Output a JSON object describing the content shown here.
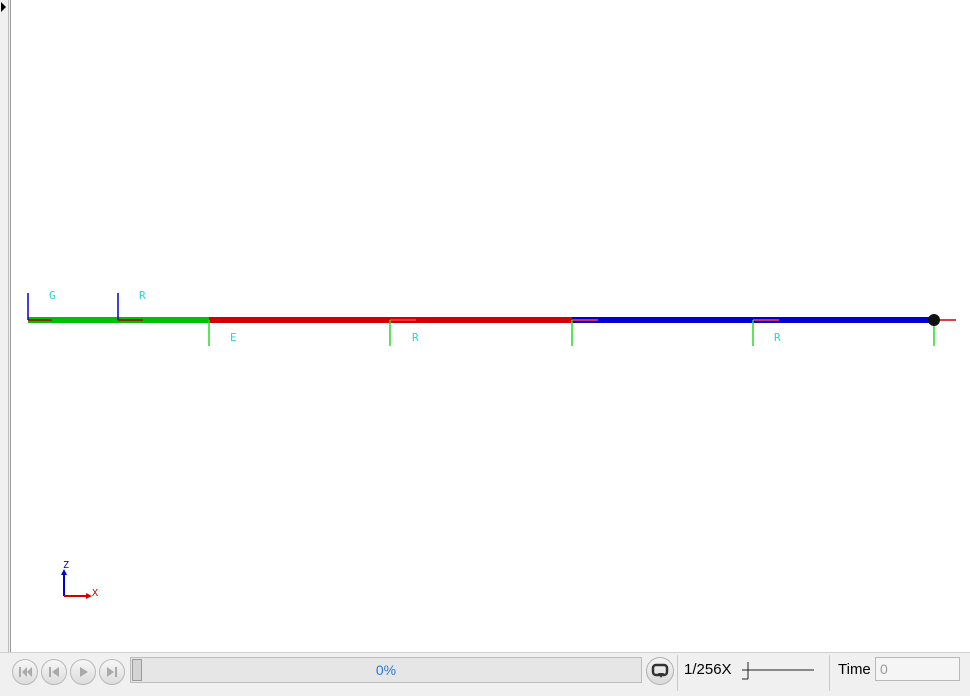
{
  "viewer": {
    "point_labels": {
      "top_1": "G",
      "top_2": "R",
      "bottom_1": "E",
      "bottom_2": "R",
      "bottom_3": "R"
    },
    "axis_triad": {
      "z": "Z",
      "x": "X"
    },
    "segment_colors": {
      "first": "#00c000",
      "second": "#d40000",
      "third": "#0000d4"
    }
  },
  "playback": {
    "progress_percent": 0,
    "progress_text": "0%",
    "speed_label": "1/256X",
    "time_label": "Time",
    "time_value": "0"
  },
  "icons": {
    "first": "skip-to-start-icon",
    "prev": "step-back-icon",
    "play": "play-icon",
    "next": "step-forward-icon",
    "loop": "loop-icon"
  }
}
